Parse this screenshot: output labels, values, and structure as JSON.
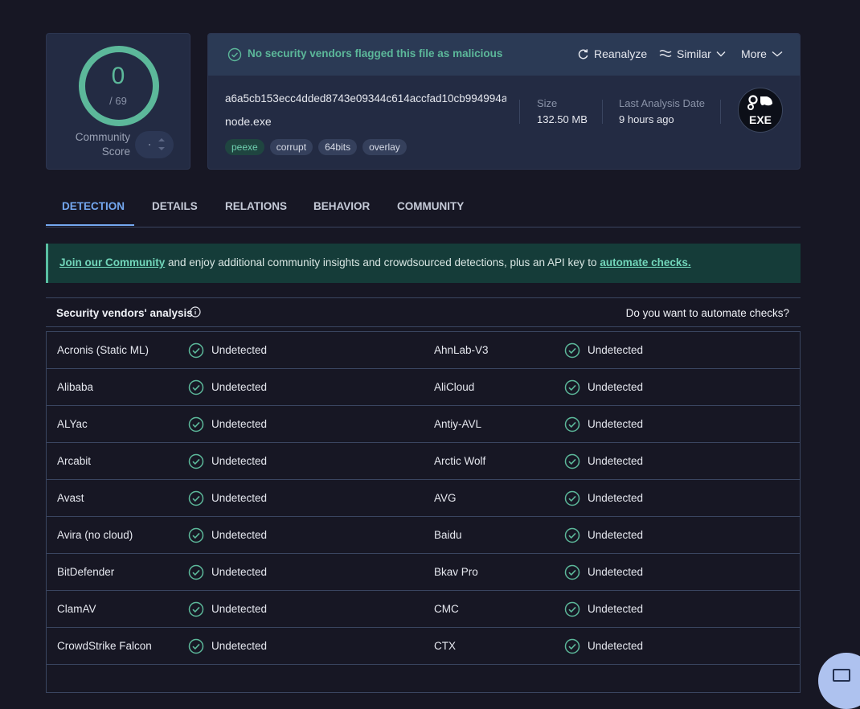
{
  "score": {
    "detections": "0",
    "total": "/ 69",
    "community_label_line1": "Community",
    "community_label_line2": "Score"
  },
  "header": {
    "status": "No security vendors flagged this file as malicious",
    "reanalyze": "Reanalyze",
    "similar": "Similar",
    "more": "More"
  },
  "file": {
    "hash": "a6a5cb153ecc4dded8743e09344c614accfad10cb994994a…",
    "name": "node.exe",
    "tags": [
      "peexe",
      "corrupt",
      "64bits",
      "overlay"
    ],
    "size_label": "Size",
    "size_value": "132.50 MB",
    "date_label": "Last Analysis Date",
    "date_value": "9 hours ago",
    "type_badge": "EXE"
  },
  "tabs": [
    "DETECTION",
    "DETAILS",
    "RELATIONS",
    "BEHAVIOR",
    "COMMUNITY"
  ],
  "active_tab": "DETECTION",
  "banner": {
    "link1": "Join our Community",
    "middle": " and enjoy additional community insights and crowdsourced detections, plus an API key to ",
    "link2": "automate checks."
  },
  "vendors_section": {
    "title": "Security vendors' analysis",
    "automate_question": "Do you want to automate checks?"
  },
  "vendors": [
    {
      "left": "Acronis (Static ML)",
      "left_result": "Undetected",
      "right": "AhnLab-V3",
      "right_result": "Undetected"
    },
    {
      "left": "Alibaba",
      "left_result": "Undetected",
      "right": "AliCloud",
      "right_result": "Undetected"
    },
    {
      "left": "ALYac",
      "left_result": "Undetected",
      "right": "Antiy-AVL",
      "right_result": "Undetected"
    },
    {
      "left": "Arcabit",
      "left_result": "Undetected",
      "right": "Arctic Wolf",
      "right_result": "Undetected"
    },
    {
      "left": "Avast",
      "left_result": "Undetected",
      "right": "AVG",
      "right_result": "Undetected"
    },
    {
      "left": "Avira (no cloud)",
      "left_result": "Undetected",
      "right": "Baidu",
      "right_result": "Undetected"
    },
    {
      "left": "BitDefender",
      "left_result": "Undetected",
      "right": "Bkav Pro",
      "right_result": "Undetected"
    },
    {
      "left": "ClamAV",
      "left_result": "Undetected",
      "right": "CMC",
      "right_result": "Undetected"
    },
    {
      "left": "CrowdStrike Falcon",
      "left_result": "Undetected",
      "right": "CTX",
      "right_result": "Undetected"
    }
  ],
  "colors": {
    "accent_green": "#5cb89a",
    "accent_blue": "#74a8f0",
    "background": "#171724"
  }
}
